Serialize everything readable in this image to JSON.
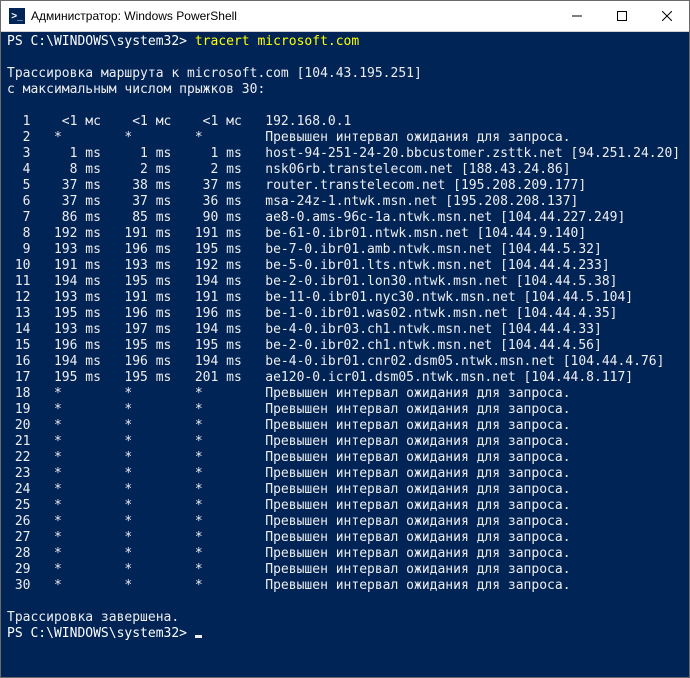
{
  "window": {
    "title": "Администратор: Windows PowerShell"
  },
  "prompt1": "PS C:\\WINDOWS\\system32> ",
  "command": "tracert microsoft.com",
  "header1": "Трассировка маршрута к microsoft.com [104.43.195.251]",
  "header2": "с максимальным числом прыжков 30:",
  "timeout_msg": "Превышен интервал ожидания для запроса.",
  "hops": [
    {
      "n": 1,
      "t1": "<1 мс",
      "t2": "<1 мс",
      "t3": "<1 мс",
      "host": "192.168.0.1"
    },
    {
      "n": 2,
      "t1": "*",
      "t2": "*",
      "t3": "*",
      "host": "TIMEOUT"
    },
    {
      "n": 3,
      "t1": "1 ms",
      "t2": "1 ms",
      "t3": "1 ms",
      "host": "host-94-251-24-20.bbcustomer.zsttk.net [94.251.24.20]"
    },
    {
      "n": 4,
      "t1": "8 ms",
      "t2": "2 ms",
      "t3": "2 ms",
      "host": "nsk06rb.transtelecom.net [188.43.24.86]"
    },
    {
      "n": 5,
      "t1": "37 ms",
      "t2": "38 ms",
      "t3": "37 ms",
      "host": "router.transtelecom.net [195.208.209.177]"
    },
    {
      "n": 6,
      "t1": "37 ms",
      "t2": "37 ms",
      "t3": "36 ms",
      "host": "msa-24z-1.ntwk.msn.net [195.208.208.137]"
    },
    {
      "n": 7,
      "t1": "86 ms",
      "t2": "85 ms",
      "t3": "90 ms",
      "host": "ae8-0.ams-96c-1a.ntwk.msn.net [104.44.227.249]"
    },
    {
      "n": 8,
      "t1": "192 ms",
      "t2": "191 ms",
      "t3": "191 ms",
      "host": "be-61-0.ibr01.ntwk.msn.net [104.44.9.140]"
    },
    {
      "n": 9,
      "t1": "193 ms",
      "t2": "196 ms",
      "t3": "195 ms",
      "host": "be-7-0.ibr01.amb.ntwk.msn.net [104.44.5.32]"
    },
    {
      "n": 10,
      "t1": "191 ms",
      "t2": "193 ms",
      "t3": "192 ms",
      "host": "be-5-0.ibr01.lts.ntwk.msn.net [104.44.4.233]"
    },
    {
      "n": 11,
      "t1": "194 ms",
      "t2": "195 ms",
      "t3": "194 ms",
      "host": "be-2-0.ibr01.lon30.ntwk.msn.net [104.44.5.38]"
    },
    {
      "n": 12,
      "t1": "193 ms",
      "t2": "191 ms",
      "t3": "191 ms",
      "host": "be-11-0.ibr01.nyc30.ntwk.msn.net [104.44.5.104]"
    },
    {
      "n": 13,
      "t1": "195 ms",
      "t2": "196 ms",
      "t3": "196 ms",
      "host": "be-1-0.ibr01.was02.ntwk.msn.net [104.44.4.35]"
    },
    {
      "n": 14,
      "t1": "193 ms",
      "t2": "197 ms",
      "t3": "194 ms",
      "host": "be-4-0.ibr03.ch1.ntwk.msn.net [104.44.4.33]"
    },
    {
      "n": 15,
      "t1": "196 ms",
      "t2": "195 ms",
      "t3": "195 ms",
      "host": "be-2-0.ibr02.ch1.ntwk.msn.net [104.44.4.56]"
    },
    {
      "n": 16,
      "t1": "194 ms",
      "t2": "196 ms",
      "t3": "194 ms",
      "host": "be-4-0.ibr01.cnr02.dsm05.ntwk.msn.net [104.44.4.76]"
    },
    {
      "n": 17,
      "t1": "195 ms",
      "t2": "195 ms",
      "t3": "201 ms",
      "host": "ae120-0.icr01.dsm05.ntwk.msn.net [104.44.8.117]"
    },
    {
      "n": 18,
      "t1": "*",
      "t2": "*",
      "t3": "*",
      "host": "TIMEOUT"
    },
    {
      "n": 19,
      "t1": "*",
      "t2": "*",
      "t3": "*",
      "host": "TIMEOUT"
    },
    {
      "n": 20,
      "t1": "*",
      "t2": "*",
      "t3": "*",
      "host": "TIMEOUT"
    },
    {
      "n": 21,
      "t1": "*",
      "t2": "*",
      "t3": "*",
      "host": "TIMEOUT"
    },
    {
      "n": 22,
      "t1": "*",
      "t2": "*",
      "t3": "*",
      "host": "TIMEOUT"
    },
    {
      "n": 23,
      "t1": "*",
      "t2": "*",
      "t3": "*",
      "host": "TIMEOUT"
    },
    {
      "n": 24,
      "t1": "*",
      "t2": "*",
      "t3": "*",
      "host": "TIMEOUT"
    },
    {
      "n": 25,
      "t1": "*",
      "t2": "*",
      "t3": "*",
      "host": "TIMEOUT"
    },
    {
      "n": 26,
      "t1": "*",
      "t2": "*",
      "t3": "*",
      "host": "TIMEOUT"
    },
    {
      "n": 27,
      "t1": "*",
      "t2": "*",
      "t3": "*",
      "host": "TIMEOUT"
    },
    {
      "n": 28,
      "t1": "*",
      "t2": "*",
      "t3": "*",
      "host": "TIMEOUT"
    },
    {
      "n": 29,
      "t1": "*",
      "t2": "*",
      "t3": "*",
      "host": "TIMEOUT"
    },
    {
      "n": 30,
      "t1": "*",
      "t2": "*",
      "t3": "*",
      "host": "TIMEOUT"
    }
  ],
  "footer": "Трассировка завершена.",
  "prompt2": "PS C:\\WINDOWS\\system32> "
}
